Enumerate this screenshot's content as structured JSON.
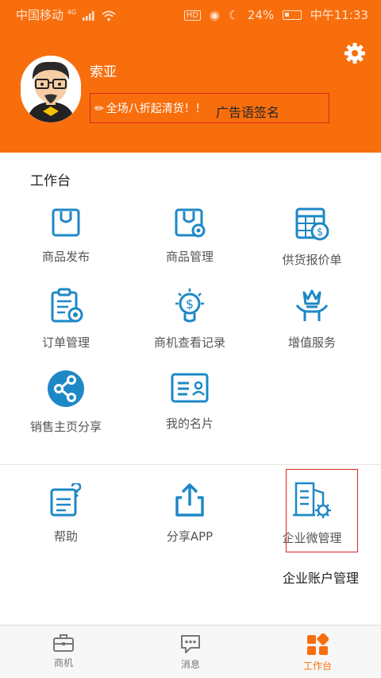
{
  "status_bar": {
    "carrier": "中国移动",
    "network": "4G",
    "battery": "24%",
    "time": "中午11:33"
  },
  "profile": {
    "name": "索亚",
    "slogan": "全场八折起清货！！",
    "signature_hint": "广告语签名"
  },
  "workbench": {
    "title": "工作台",
    "items": [
      {
        "label": "商品发布",
        "icon": "bag-icon"
      },
      {
        "label": "商品管理",
        "icon": "bag-settings-icon"
      },
      {
        "label": "供货报价单",
        "icon": "price-sheet-icon"
      },
      {
        "label": "订单管理",
        "icon": "order-clipboard-icon"
      },
      {
        "label": "商机查看记录",
        "icon": "dollar-bulb-icon"
      },
      {
        "label": "增值服务",
        "icon": "crown-hand-icon"
      },
      {
        "label": "销售主页分享",
        "icon": "share-circle-icon"
      },
      {
        "label": "我的名片",
        "icon": "business-card-icon"
      }
    ]
  },
  "tools": {
    "items": [
      {
        "label": "帮助",
        "icon": "help-document-icon"
      },
      {
        "label": "分享APP",
        "icon": "upload-share-icon"
      },
      {
        "label": "企业微管理",
        "icon": "building-gear-icon"
      }
    ],
    "annotation": "企业账户管理"
  },
  "tabbar": {
    "items": [
      {
        "label": "商机",
        "icon": "briefcase-icon"
      },
      {
        "label": "消息",
        "icon": "chat-bubble-icon"
      },
      {
        "label": "工作台",
        "icon": "workbench-grid-icon",
        "active": true
      }
    ]
  },
  "colors": {
    "brand": "#f86e0d",
    "icon_blue": "#1e88c7",
    "highlight_red": "#e0251d"
  }
}
